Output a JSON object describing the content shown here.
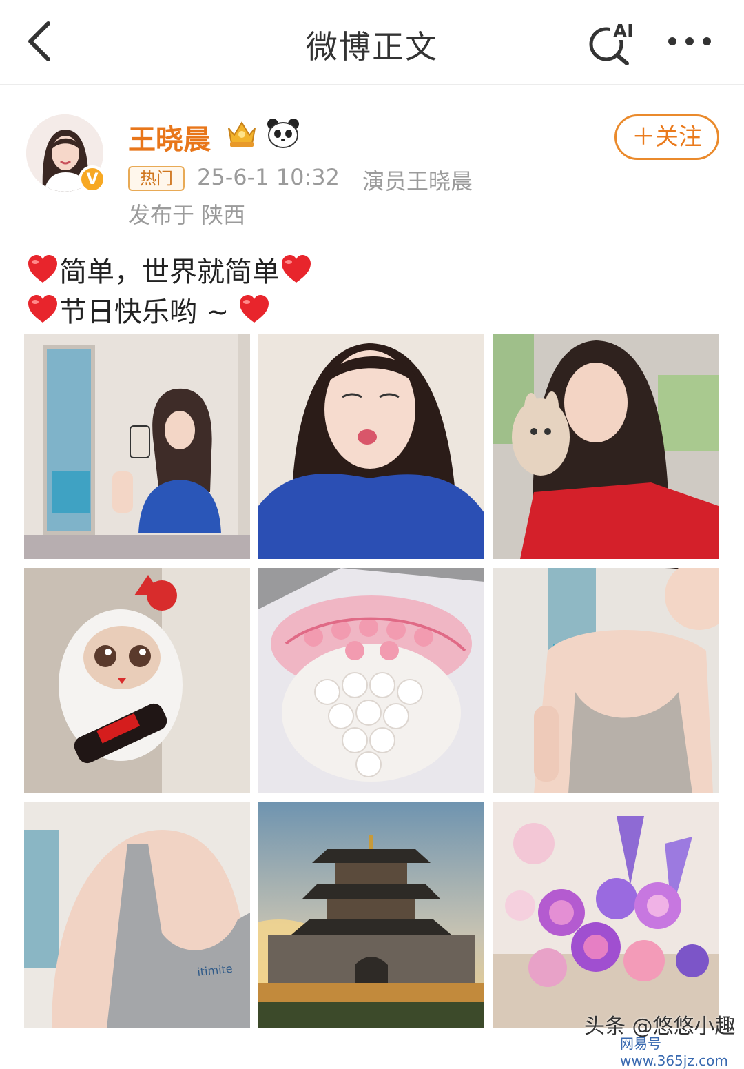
{
  "header": {
    "title": "微博正文",
    "ai_label": "AI"
  },
  "post": {
    "author": "王晓晨",
    "verified_mark": "V",
    "follow_label": "＋关注",
    "hot_tag": "热门",
    "time": "25-6-1 10:32",
    "source": "演员王晓晨",
    "location": "发布于 陕西",
    "text_line1": "简单，世界就简单",
    "text_line2": "节日快乐哟 ~ "
  },
  "images": [
    {
      "subject": "mirror selfie in blue shirt"
    },
    {
      "subject": "kissy-face close-up"
    },
    {
      "subject": "car selfie with plush toy"
    },
    {
      "subject": "white plush doll with cola bottle"
    },
    {
      "subject": "pink and white rose bouquet"
    },
    {
      "subject": "grey tank top photo"
    },
    {
      "subject": "grey tank top close-up"
    },
    {
      "subject": "Xi'an Bell Tower at sunset"
    },
    {
      "subject": "purple and pink flower bouquet"
    }
  ],
  "watermark": {
    "main": "头条 @悠悠小趣",
    "sub": "网易号 www.365jz.com"
  },
  "colors": {
    "accent": "#e8761a",
    "meta_gray": "#9b9b9b",
    "verified": "#f7a823"
  }
}
